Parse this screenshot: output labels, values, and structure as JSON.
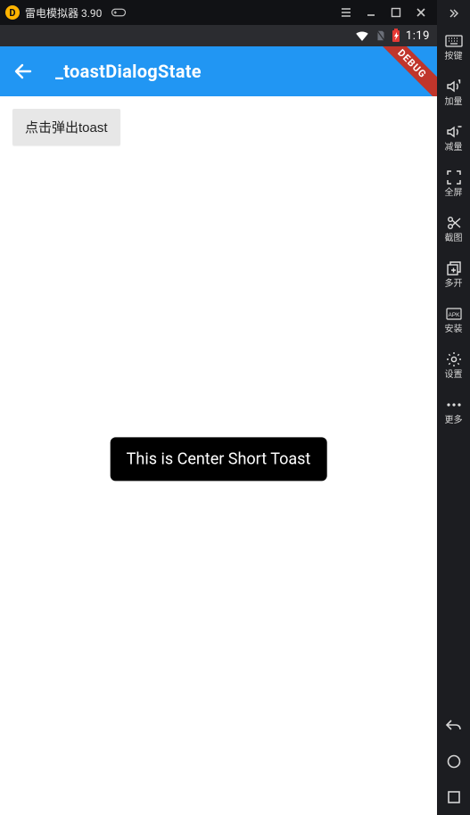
{
  "emulator": {
    "title_prefix": "雷电模拟器",
    "version": "3.90"
  },
  "android_status": {
    "time": "1:19",
    "debug_ribbon": "DEBUG"
  },
  "app": {
    "title": "_toastDialogState",
    "show_toast_button": "点击弹出toast",
    "toast_message": "This is Center Short Toast"
  },
  "sidebar": {
    "tools": [
      {
        "id": "keymap",
        "label": "按键"
      },
      {
        "id": "volume_up",
        "label": "加量"
      },
      {
        "id": "volume_down",
        "label": "减量"
      },
      {
        "id": "fullscreen",
        "label": "全屏"
      },
      {
        "id": "screenshot",
        "label": "截图"
      },
      {
        "id": "multi",
        "label": "多开"
      },
      {
        "id": "install",
        "label": "安装"
      },
      {
        "id": "settings",
        "label": "设置"
      },
      {
        "id": "more",
        "label": "更多"
      }
    ]
  }
}
